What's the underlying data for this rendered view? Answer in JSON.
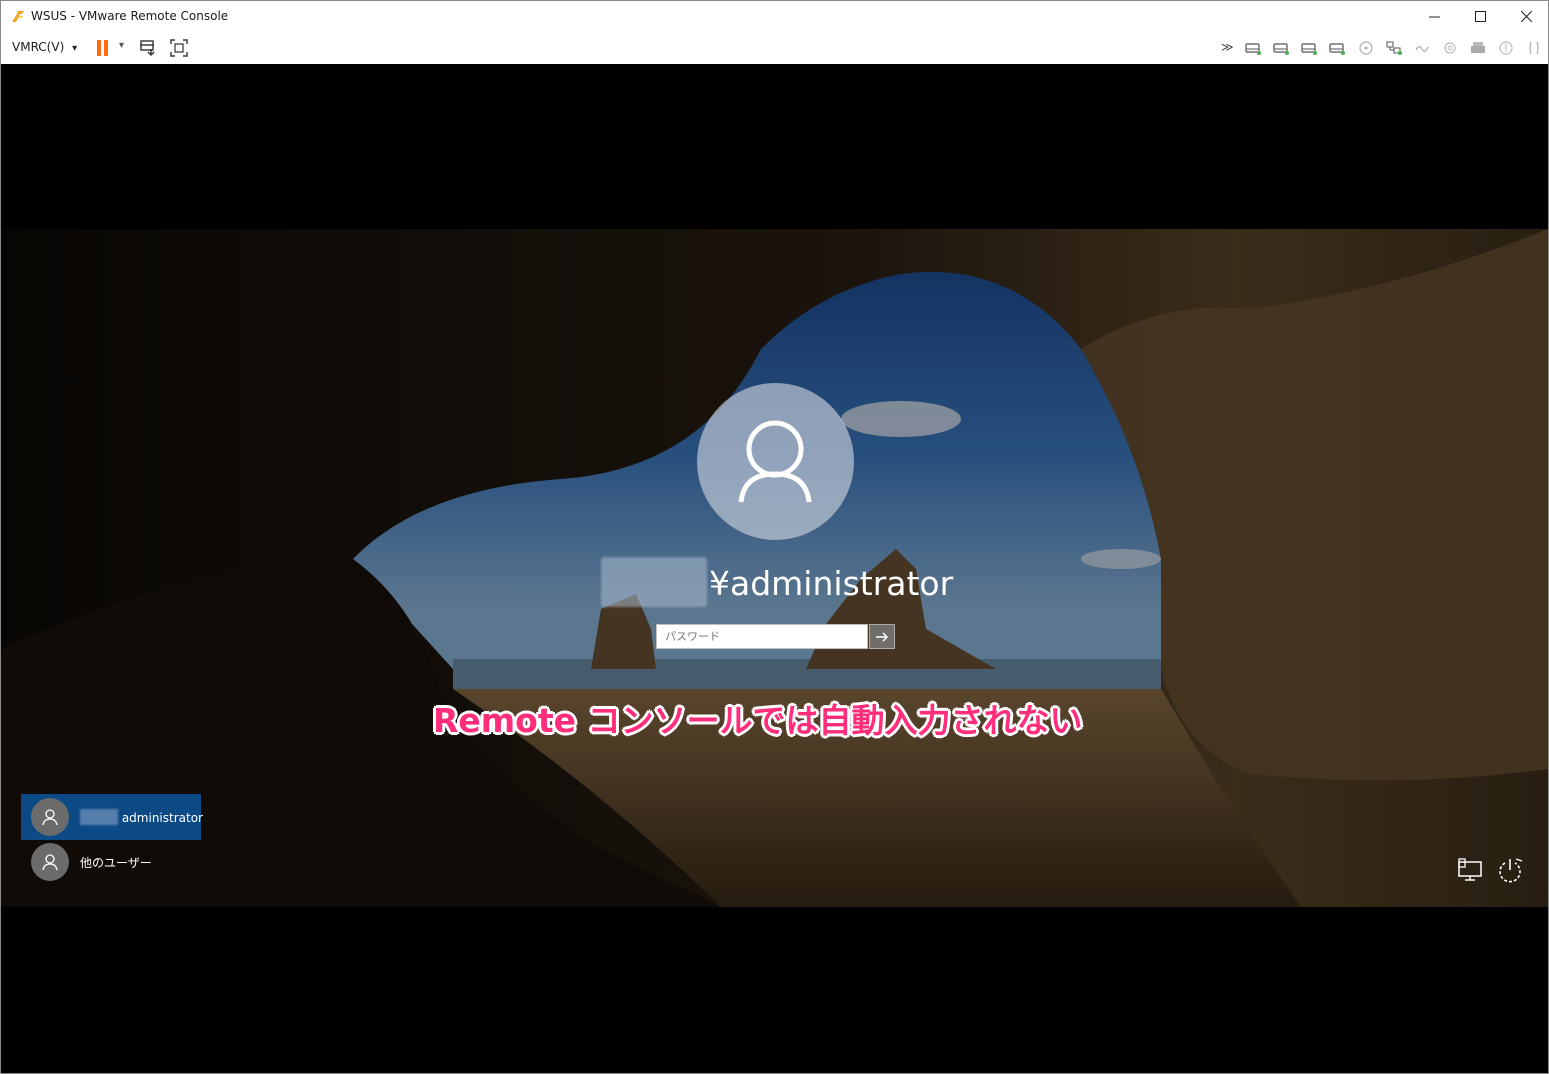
{
  "window": {
    "title": "WSUS - VMware Remote Console",
    "controls": {
      "minimize": "─",
      "maximize": "☐",
      "close": "✕"
    }
  },
  "toolbar": {
    "menu_label": "VMRC(V)",
    "menu_caret": "▾",
    "power_caret": "▾",
    "device_overflow": "≫",
    "device_icons": [
      "hdd-icon",
      "hdd-icon",
      "hdd-icon",
      "hdd-icon",
      "cd-icon",
      "network-icon",
      "usb-icon",
      "sound-icon",
      "printer-icon",
      "sound-card-icon",
      "settings-icon"
    ]
  },
  "lockscreen": {
    "username_suffix": "¥administrator",
    "password_placeholder": "パスワード",
    "annotation": "Remote コンソールでは自動入力されない",
    "users": [
      {
        "label": "administrator",
        "selected": true
      },
      {
        "label": "他のユーザー",
        "selected": false
      }
    ]
  },
  "colors": {
    "accent_pause": "#ff6a13",
    "selected_tile": "#0c4a86",
    "annotation": "#ff2d7a"
  }
}
